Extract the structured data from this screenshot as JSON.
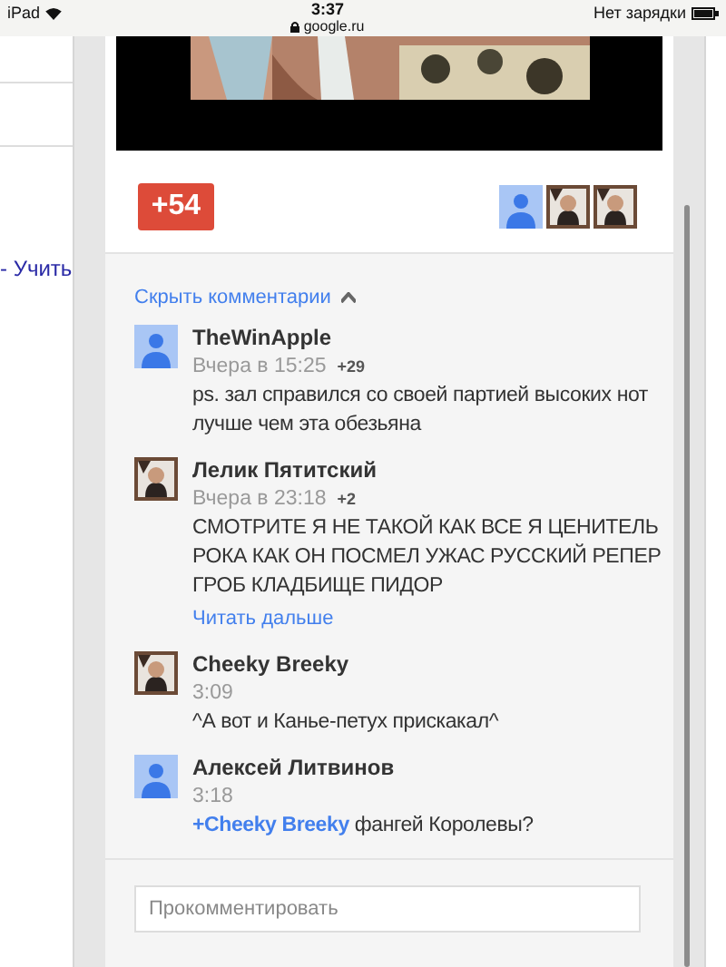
{
  "status_bar": {
    "device": "iPad",
    "time": "3:37",
    "url": "google.ru",
    "battery_text": "Нет зарядки"
  },
  "left_page": {
    "link": "- Учить"
  },
  "post": {
    "video": {
      "kind": "picture"
    },
    "plus_button": "+54",
    "plusoners": [
      {
        "kind": "default"
      },
      {
        "kind": "picture"
      },
      {
        "kind": "picture"
      }
    ]
  },
  "comments_toggle": {
    "label": "Скрыть комментарии",
    "expanded": true
  },
  "comments": [
    {
      "avatar": {
        "kind": "default"
      },
      "author": "TheWinApple",
      "time": "Вчера в 15:25",
      "plus": "+29",
      "text": "ps. зал справился со своей партией высоких нот лучше чем эта обезьяна"
    },
    {
      "avatar": {
        "kind": "picture"
      },
      "author": "Лелик Пятитский",
      "time": "Вчера в 23:18",
      "plus": "+2",
      "text": "СМОТРИТЕ Я НЕ ТАКОЙ КАК ВСЕ Я ЦЕНИТЕЛЬ РОКА КАК ОН ПОСМЕЛ УЖАС РУССКИЙ РЕПЕР ГРОБ КЛАДБИЩЕ ПИДОР",
      "read_more": "Читать дальше"
    },
    {
      "avatar": {
        "kind": "picture"
      },
      "author": "Cheeky Breeky",
      "time": "3:09",
      "text": "^А вот и Канье-петух прискакал^"
    },
    {
      "avatar": {
        "kind": "default"
      },
      "author": "Алексей Литвинов",
      "time": "3:18",
      "mention": "+Cheeky Breeky",
      "text": "фангей Королевы?"
    }
  ],
  "comment_field": {
    "placeholder": "Прокомментировать"
  }
}
